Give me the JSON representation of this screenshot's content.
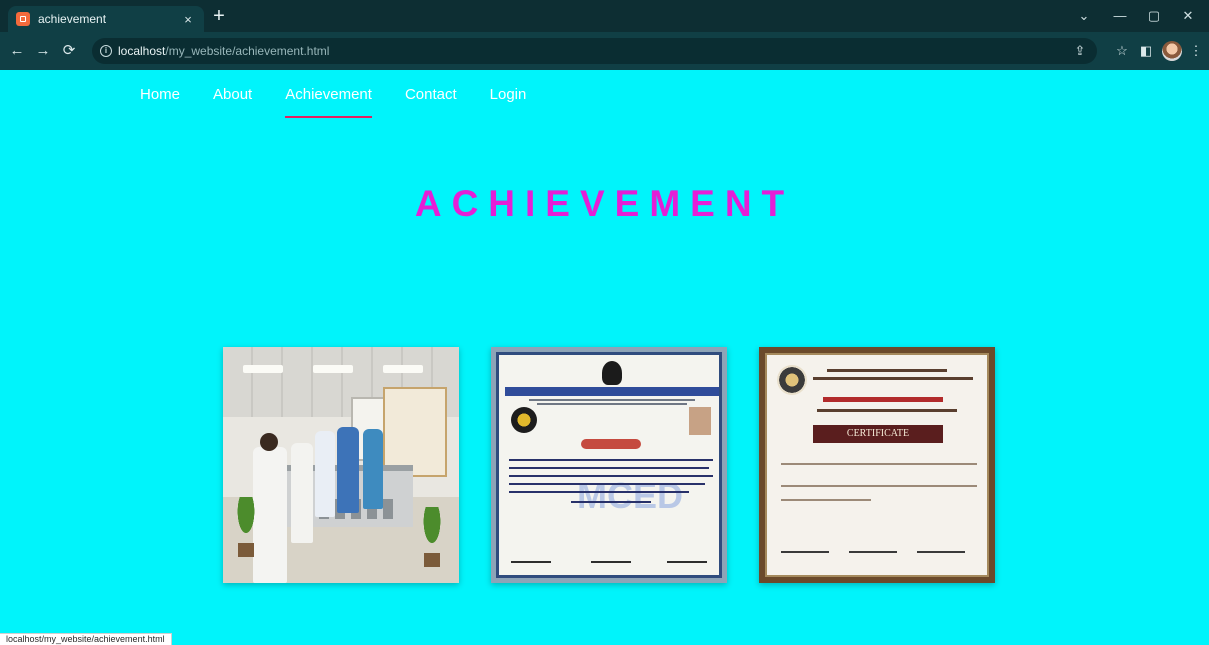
{
  "browser": {
    "tab_title": "achievement",
    "tab_close": "×",
    "new_tab": "+",
    "url_host": "localhost",
    "url_path": "/my_website/achievement.html",
    "status_url": "localhost/my_website/achievement.html",
    "controls": {
      "dropdown": "⌄",
      "minimize": "—",
      "restore": "▢",
      "close": "✕"
    },
    "nav": {
      "back": "←",
      "forward": "→",
      "reload": "⟳"
    },
    "toolbar": {
      "share": "⇪",
      "bookmark": "☆",
      "sidepanel": "◧",
      "menu": "⋮"
    }
  },
  "site": {
    "nav": [
      {
        "label": "Home",
        "active": false
      },
      {
        "label": "About",
        "active": false
      },
      {
        "label": "Achievement",
        "active": true
      },
      {
        "label": "Contact",
        "active": false
      },
      {
        "label": "Login",
        "active": false
      }
    ],
    "heading": "ACHIEVEMENT",
    "cert1_watermark": "MCED",
    "cert2_banner": "CERTIFICATE"
  },
  "colors": {
    "background": "#00f4fb",
    "heading": "#e51ed6",
    "nav_underline": "#e4205f"
  }
}
